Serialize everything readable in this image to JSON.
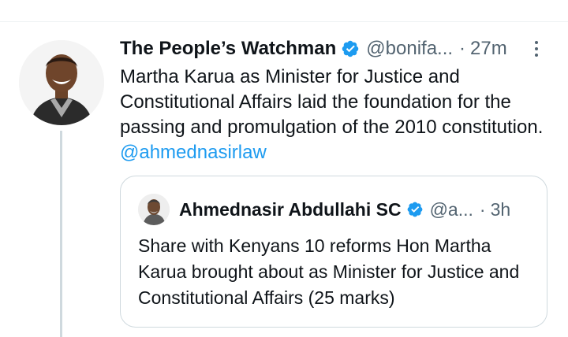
{
  "tweet": {
    "display_name": "The People’s Watchman",
    "handle": "@bonifa...",
    "separator": "·",
    "time": "27m",
    "text": "Martha Karua as Minister for Justice and Constitutional Affairs laid the foundation for the passing and promulgation of the 2010 constitution. ",
    "mention": "@ahmednasirlaw"
  },
  "quoted_tweet": {
    "display_name": "Ahmednasir Abdullahi SC",
    "handle": "@a...",
    "separator": "·",
    "time": "3h",
    "text": "Share with Kenyans 10 reforms Hon Martha Karua brought about as Minister for Justice and Constitutional Affairs (25 marks)"
  },
  "icons": {
    "verified": "verified-badge-icon",
    "more": "more-options-icon"
  },
  "colors": {
    "accent": "#1d9bf0",
    "text": "#0f1419",
    "muted": "#536471",
    "border": "#cfd9de"
  }
}
